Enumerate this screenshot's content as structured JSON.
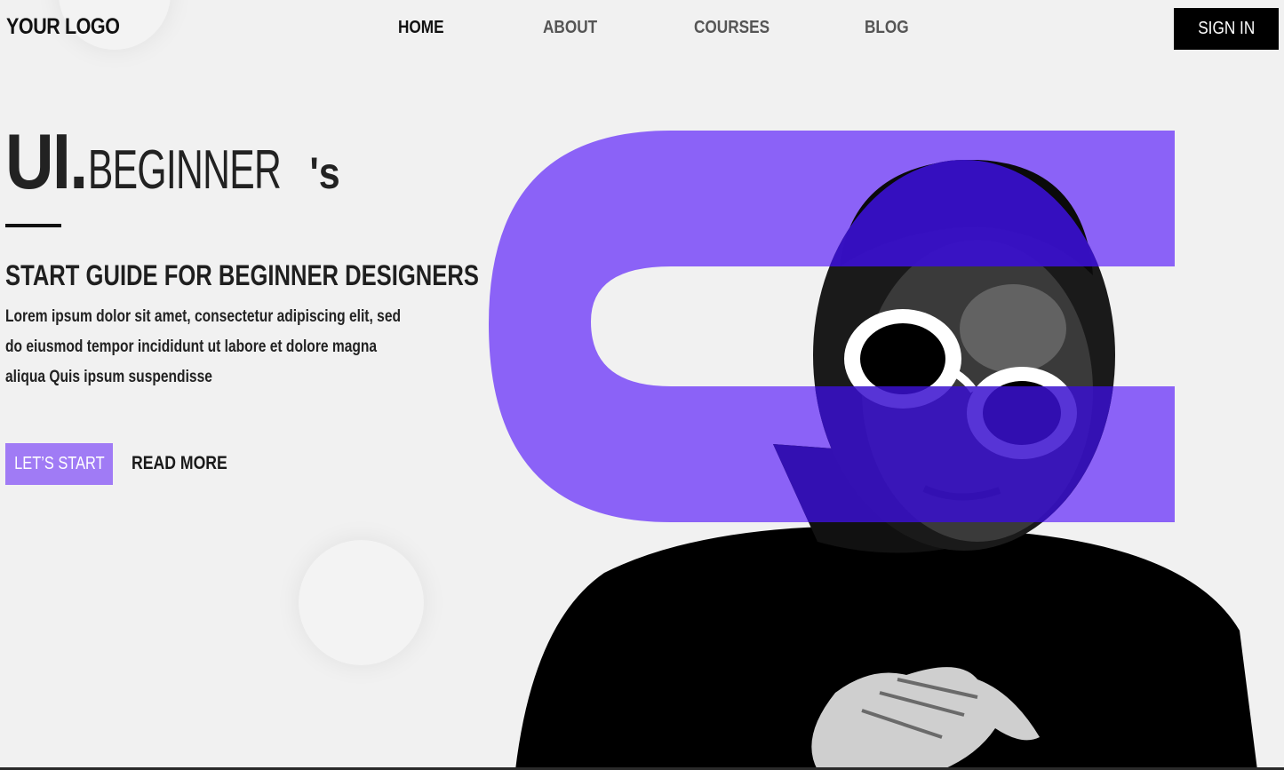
{
  "header": {
    "logo": "YOUR LOGO",
    "nav": [
      {
        "label": "HOME",
        "active": true
      },
      {
        "label": "ABOUT",
        "active": false
      },
      {
        "label": "COURSES",
        "active": false
      },
      {
        "label": "BLOG",
        "active": false
      }
    ],
    "signin_label": "SIGN IN"
  },
  "hero": {
    "title_ui": "UI",
    "title_dot": ".",
    "title_beginner": "BEGINNER",
    "title_suffix": "'s",
    "subtitle": "START GUIDE FOR BEGINNER DESIGNERS",
    "lead": "Lorem ipsum dolor sit amet, consectetur adipiscing elit, sed do eiusmod tempor incididunt ut labore et dolore magna aliqua Quis ipsum suspendisse",
    "primary_button": "LET’S START",
    "secondary_link": "READ MORE",
    "image_description_icon": "person-with-white-sunglasses-photo"
  },
  "colors": {
    "accent": "#a07bf5",
    "brand_shape": "#8b62f7",
    "overlay": "#3a10cf",
    "background": "#f1f1f1",
    "text": "#111111"
  }
}
